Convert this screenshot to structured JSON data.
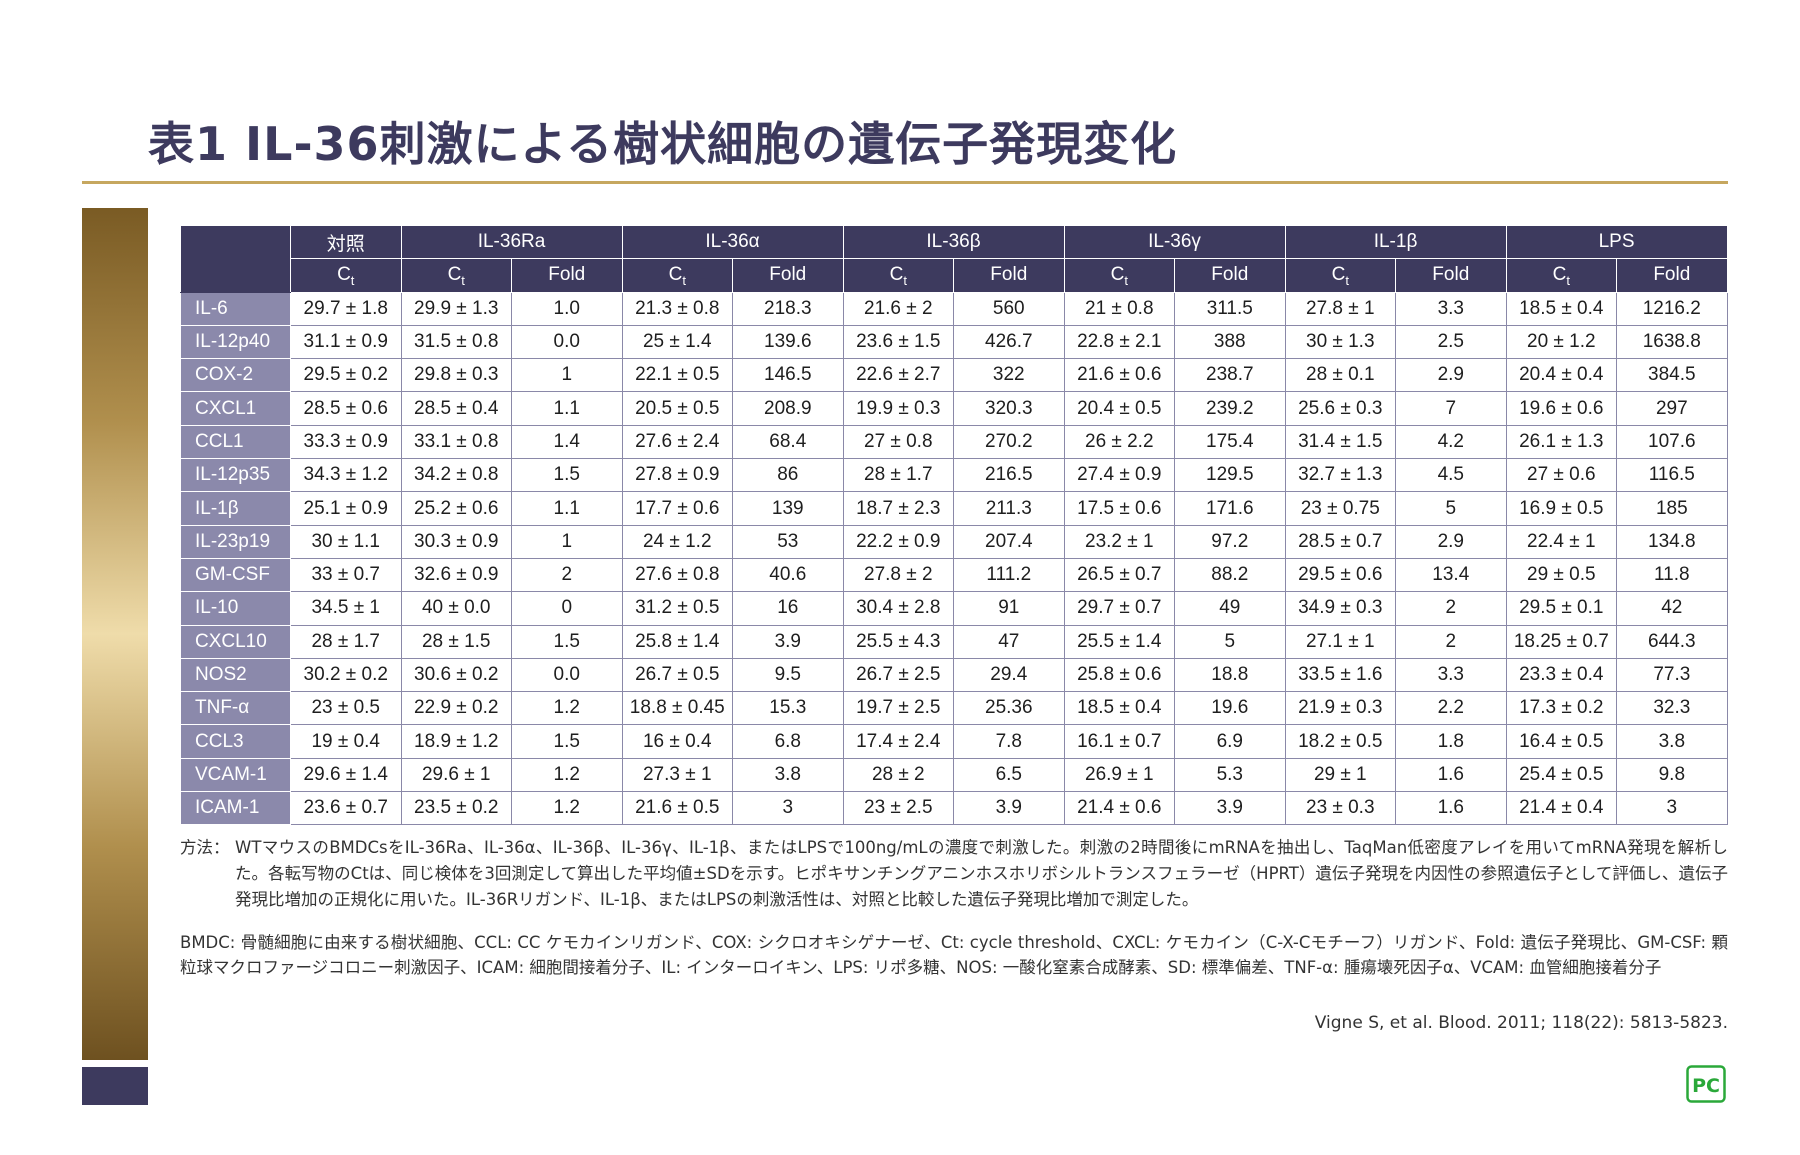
{
  "title": "表1 IL-36刺激による樹状細胞の遺伝子発現変化",
  "table": {
    "groups": [
      "対照",
      "IL-36Ra",
      "IL-36α",
      "IL-36β",
      "IL-36γ",
      "IL-1β",
      "LPS"
    ],
    "subheaders": [
      "Ct",
      "Ct",
      "Fold",
      "Ct",
      "Fold",
      "Ct",
      "Fold",
      "Ct",
      "Fold",
      "Ct",
      "Fold",
      "Ct",
      "Fold"
    ],
    "rows": [
      {
        "gene": "IL-6",
        "values": [
          "29.7 ± 1.8",
          "29.9 ± 1.3",
          "1.0",
          "21.3 ± 0.8",
          "218.3",
          "21.6 ± 2",
          "560",
          "21 ± 0.8",
          "311.5",
          "27.8 ± 1",
          "3.3",
          "18.5 ± 0.4",
          "1216.2"
        ]
      },
      {
        "gene": "IL-12p40",
        "values": [
          "31.1 ± 0.9",
          "31.5 ± 0.8",
          "0.0",
          "25 ± 1.4",
          "139.6",
          "23.6 ± 1.5",
          "426.7",
          "22.8 ± 2.1",
          "388",
          "30 ± 1.3",
          "2.5",
          "20 ± 1.2",
          "1638.8"
        ]
      },
      {
        "gene": "COX-2",
        "values": [
          "29.5 ± 0.2",
          "29.8 ± 0.3",
          "1",
          "22.1 ± 0.5",
          "146.5",
          "22.6 ± 2.7",
          "322",
          "21.6 ± 0.6",
          "238.7",
          "28 ± 0.1",
          "2.9",
          "20.4 ± 0.4",
          "384.5"
        ]
      },
      {
        "gene": "CXCL1",
        "values": [
          "28.5 ± 0.6",
          "28.5 ± 0.4",
          "1.1",
          "20.5 ± 0.5",
          "208.9",
          "19.9 ± 0.3",
          "320.3",
          "20.4 ± 0.5",
          "239.2",
          "25.6 ± 0.3",
          "7",
          "19.6 ± 0.6",
          "297"
        ]
      },
      {
        "gene": "CCL1",
        "values": [
          "33.3 ± 0.9",
          "33.1 ± 0.8",
          "1.4",
          "27.6 ± 2.4",
          "68.4",
          "27 ± 0.8",
          "270.2",
          "26 ± 2.2",
          "175.4",
          "31.4 ± 1.5",
          "4.2",
          "26.1 ± 1.3",
          "107.6"
        ]
      },
      {
        "gene": "IL-12p35",
        "values": [
          "34.3 ± 1.2",
          "34.2 ± 0.8",
          "1.5",
          "27.8 ± 0.9",
          "86",
          "28 ± 1.7",
          "216.5",
          "27.4 ± 0.9",
          "129.5",
          "32.7 ± 1.3",
          "4.5",
          "27 ± 0.6",
          "116.5"
        ]
      },
      {
        "gene": "IL-1β",
        "values": [
          "25.1 ± 0.9",
          "25.2 ± 0.6",
          "1.1",
          "17.7 ± 0.6",
          "139",
          "18.7 ± 2.3",
          "211.3",
          "17.5 ± 0.6",
          "171.6",
          "23 ± 0.75",
          "5",
          "16.9 ± 0.5",
          "185"
        ]
      },
      {
        "gene": "IL-23p19",
        "values": [
          "30 ± 1.1",
          "30.3 ± 0.9",
          "1",
          "24 ± 1.2",
          "53",
          "22.2 ± 0.9",
          "207.4",
          "23.2 ± 1",
          "97.2",
          "28.5 ± 0.7",
          "2.9",
          "22.4 ± 1",
          "134.8"
        ]
      },
      {
        "gene": "GM-CSF",
        "values": [
          "33 ± 0.7",
          "32.6 ± 0.9",
          "2",
          "27.6 ± 0.8",
          "40.6",
          "27.8 ± 2",
          "111.2",
          "26.5 ± 0.7",
          "88.2",
          "29.5 ± 0.6",
          "13.4",
          "29 ± 0.5",
          "11.8"
        ]
      },
      {
        "gene": "IL-10",
        "values": [
          "34.5 ± 1",
          "40 ± 0.0",
          "0",
          "31.2 ± 0.5",
          "16",
          "30.4 ± 2.8",
          "91",
          "29.7 ± 0.7",
          "49",
          "34.9 ± 0.3",
          "2",
          "29.5 ± 0.1",
          "42"
        ]
      },
      {
        "gene": "CXCL10",
        "values": [
          "28 ± 1.7",
          "28 ± 1.5",
          "1.5",
          "25.8 ± 1.4",
          "3.9",
          "25.5 ± 4.3",
          "47",
          "25.5 ± 1.4",
          "5",
          "27.1 ± 1",
          "2",
          "18.25 ± 0.7",
          "644.3"
        ]
      },
      {
        "gene": "NOS2",
        "values": [
          "30.2 ± 0.2",
          "30.6 ± 0.2",
          "0.0",
          "26.7 ± 0.5",
          "9.5",
          "26.7 ± 2.5",
          "29.4",
          "25.8 ± 0.6",
          "18.8",
          "33.5 ± 1.6",
          "3.3",
          "23.3 ± 0.4",
          "77.3"
        ]
      },
      {
        "gene": "TNF-α",
        "values": [
          "23 ± 0.5",
          "22.9 ± 0.2",
          "1.2",
          "18.8 ± 0.45",
          "15.3",
          "19.7 ± 2.5",
          "25.36",
          "18.5 ± 0.4",
          "19.6",
          "21.9 ± 0.3",
          "2.2",
          "17.3 ± 0.2",
          "32.3"
        ]
      },
      {
        "gene": "CCL3",
        "values": [
          "19 ± 0.4",
          "18.9 ± 1.2",
          "1.5",
          "16 ± 0.4",
          "6.8",
          "17.4 ± 2.4",
          "7.8",
          "16.1 ± 0.7",
          "6.9",
          "18.2 ± 0.5",
          "1.8",
          "16.4 ± 0.5",
          "3.8"
        ]
      },
      {
        "gene": "VCAM-1",
        "values": [
          "29.6 ± 1.4",
          "29.6 ± 1",
          "1.2",
          "27.3 ± 1",
          "3.8",
          "28 ± 2",
          "6.5",
          "26.9 ± 1",
          "5.3",
          "29 ± 1",
          "1.6",
          "25.4 ± 0.5",
          "9.8"
        ]
      },
      {
        "gene": "ICAM-1",
        "values": [
          "23.6 ± 0.7",
          "23.5 ± 0.2",
          "1.2",
          "21.6 ± 0.5",
          "3",
          "23 ± 2.5",
          "3.9",
          "21.4 ± 0.6",
          "3.9",
          "23 ± 0.3",
          "1.6",
          "21.4 ± 0.4",
          "3"
        ]
      }
    ]
  },
  "methods_label": "方法：",
  "methods_text": "WTマウスのBMDCsをIL-36Ra、IL-36α、IL-36β、IL-36γ、IL-1β、またはLPSで100ng/mLの濃度で刺激した。刺激の2時間後にmRNAを抽出し、TaqMan低密度アレイを用いてmRNA発現を解析した。各転写物のCtは、同じ検体を3回測定して算出した平均値±SDを示す。ヒポキサンチングアニンホスホリボシルトランスフェラーゼ（HPRT）遺伝子発現を内因性の参照遺伝子として評価し、遺伝子発現比増加の正規化に用いた。IL-36Rリガンド、IL-1β、またはLPSの刺激活性は、対照と比較した遺伝子発現比増加で測定した。",
  "abbreviations": "BMDC: 骨髄細胞に由来する樹状細胞、CCL: CC ケモカインリガンド、COX: シクロオキシゲナーゼ、Ct: cycle threshold、CXCL: ケモカイン（C-X-Cモチーフ）リガンド、Fold: 遺伝子発現比、GM-CSF: 顆粒球マクロファージコロニー刺激因子、ICAM: 細胞間接着分子、IL: インターロイキン、LPS: リポ多糖、NOS: 一酸化窒素合成酵素、SD: 標準偏差、TNF-α: 腫瘍壊死因子α、VCAM: 血管細胞接着分子",
  "citation": "Vigne S, et al. Blood. 2011; 118(22): 5813-5823.",
  "logo_text": "PC",
  "colors": {
    "header_bg": "#3d3a5e",
    "rowhead_bg": "#8b89ab",
    "accent_gold": "#c6a75f",
    "logo_green": "#2aa839"
  }
}
